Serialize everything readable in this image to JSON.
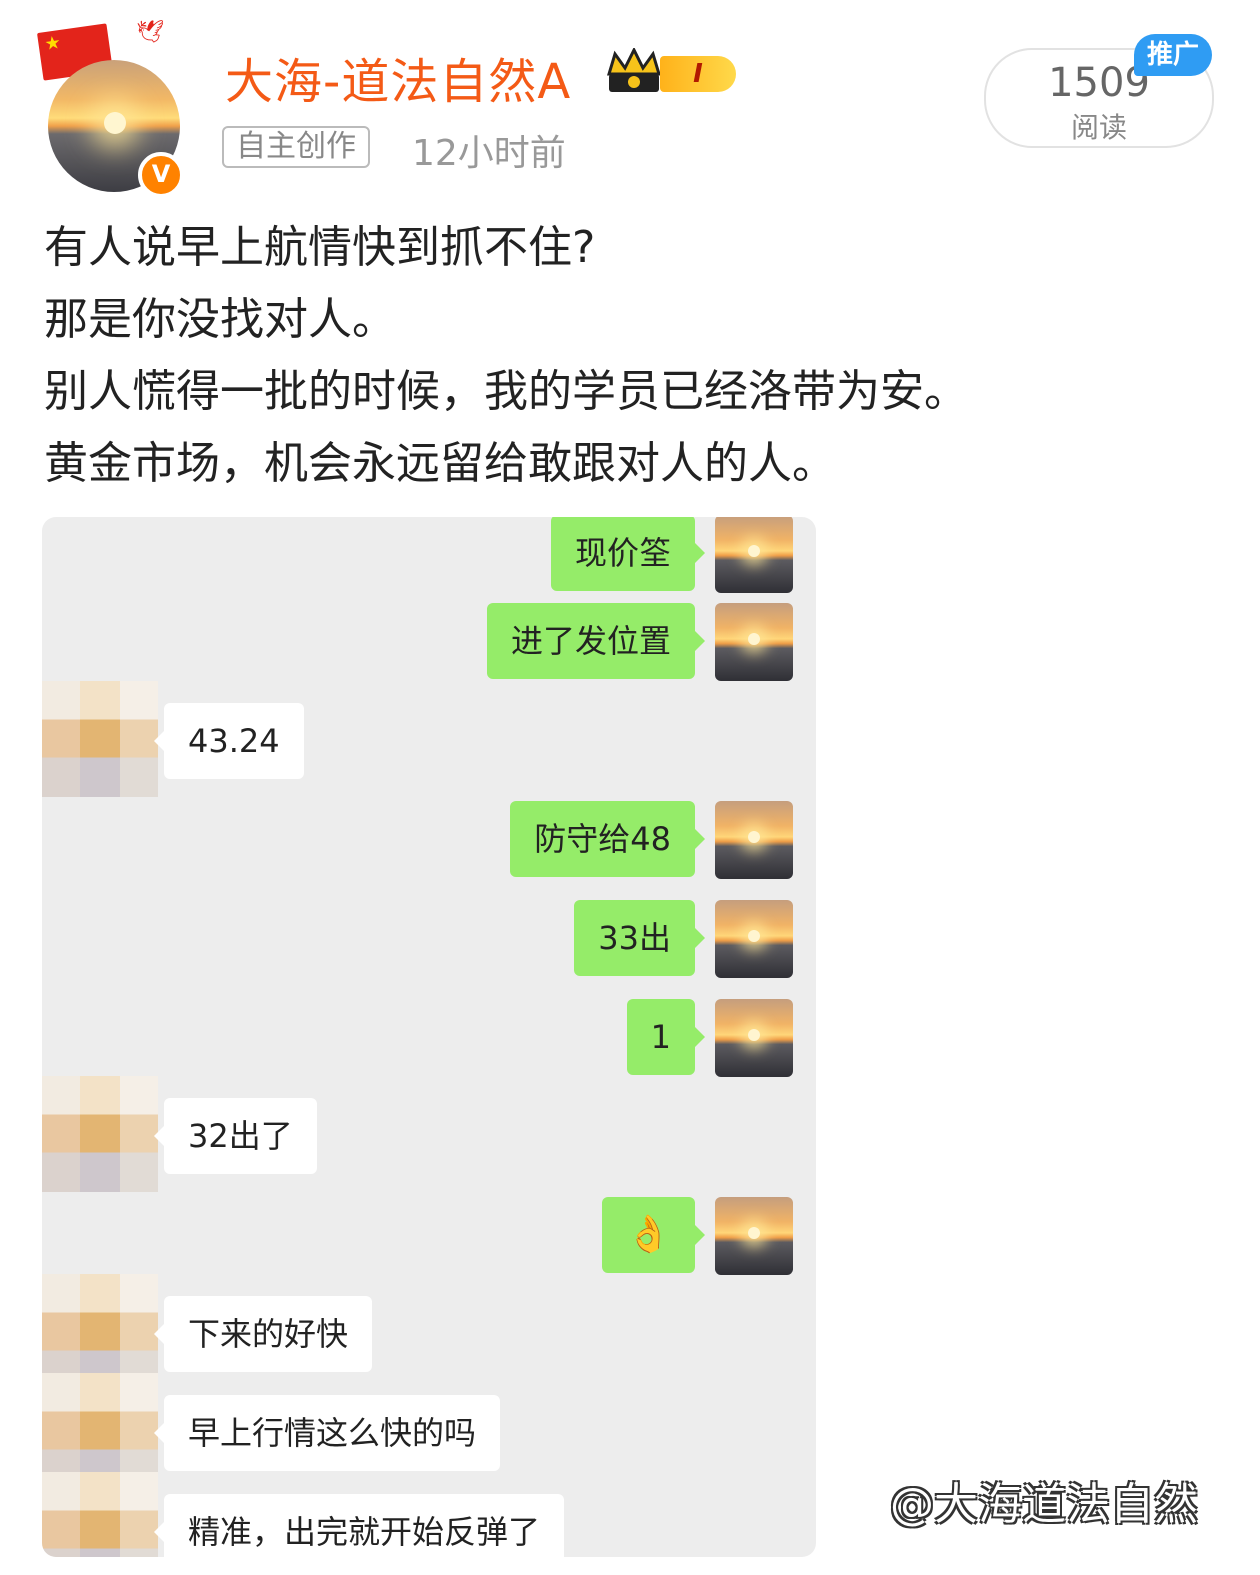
{
  "header": {
    "flag_icon": "china-flag-icon",
    "username": "大海-道法自然A",
    "level_badge": "I",
    "verified_mark": "V",
    "tag": "自主创作",
    "time": "12小时前",
    "reads_count": "1509",
    "reads_label": "阅读",
    "promo_badge": "推广"
  },
  "post": {
    "lines": [
      "有人说早上航情快到抓不住?",
      "那是你没找对人。",
      "别人慌得一批的时候，我的学员已经洛带为安。",
      "黄金市场，机会永远留给敢跟对人的人。"
    ]
  },
  "chat": {
    "messages": [
      {
        "side": "out",
        "text": "现价筌"
      },
      {
        "side": "out",
        "text": "进了发位置"
      },
      {
        "side": "in",
        "text": "43.24"
      },
      {
        "side": "out",
        "text": "防守给48"
      },
      {
        "side": "out",
        "text": "33出"
      },
      {
        "side": "out",
        "text": "1"
      },
      {
        "side": "in",
        "text": "32出了"
      },
      {
        "side": "out",
        "text": "👌"
      },
      {
        "side": "in",
        "text": "下来的好快"
      },
      {
        "side": "in",
        "text": "早上行情这么快的吗"
      },
      {
        "side": "in",
        "text": "精准，出完就开始反弹了"
      }
    ]
  },
  "watermark": "@大海道法自然",
  "colors": {
    "username": "#f45a16",
    "bubble_out": "#95ec69",
    "bubble_in": "#ffffff",
    "chat_bg": "#ededed",
    "promo": "#2f9cf3",
    "verify": "#ff8200"
  }
}
